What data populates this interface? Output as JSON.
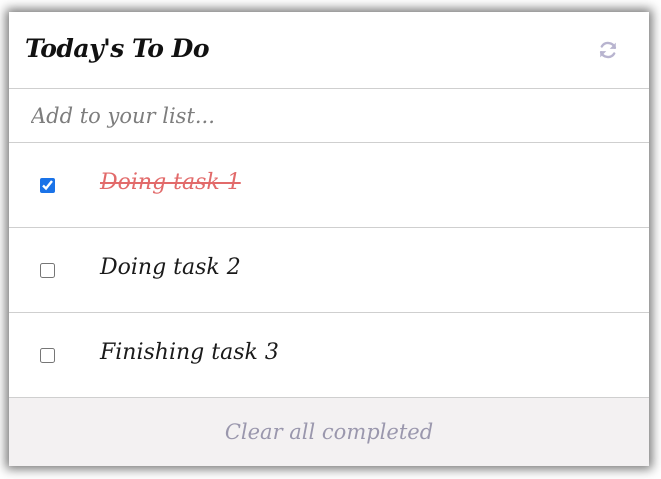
{
  "header": {
    "title": "Today's To Do",
    "refresh_icon": "refresh-icon"
  },
  "add": {
    "placeholder": "Add to your list...",
    "value": ""
  },
  "tasks": [
    {
      "label": "Doing task 1",
      "checked": true
    },
    {
      "label": "Doing task 2",
      "checked": false
    },
    {
      "label": "Finishing task 3",
      "checked": false
    }
  ],
  "footer": {
    "clear_label": "Clear all completed"
  },
  "colors": {
    "completed_text": "#e26a6a",
    "checkbox_accent": "#1a73e8",
    "footer_bg": "#f3f1f2",
    "footer_text": "#9a97ad",
    "refresh_icon": "#b8b4cf"
  }
}
